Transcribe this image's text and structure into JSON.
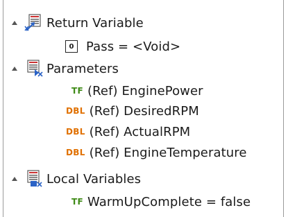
{
  "tree": {
    "return_variable": {
      "label": "Return Variable",
      "icon": "return-variable-icon",
      "items": [
        {
          "type_badge": "0",
          "text": "Pass = <Void>"
        }
      ]
    },
    "parameters": {
      "label": "Parameters",
      "icon": "parameters-icon",
      "items": [
        {
          "type_badge": "TF",
          "text": "(Ref) EnginePower"
        },
        {
          "type_badge": "DBL",
          "text": "(Ref) DesiredRPM"
        },
        {
          "type_badge": "DBL",
          "text": "(Ref) ActualRPM"
        },
        {
          "type_badge": "DBL",
          "text": "(Ref) EngineTemperature"
        }
      ]
    },
    "local_variables": {
      "label": "Local Variables",
      "icon": "local-variables-icon",
      "items": [
        {
          "type_badge": "TF",
          "text": "WarmUpComplete = false"
        }
      ]
    }
  },
  "colors": {
    "boolean_badge": "#3e8a16",
    "double_badge": "#e07000",
    "icon_blue": "#2b63c6"
  }
}
